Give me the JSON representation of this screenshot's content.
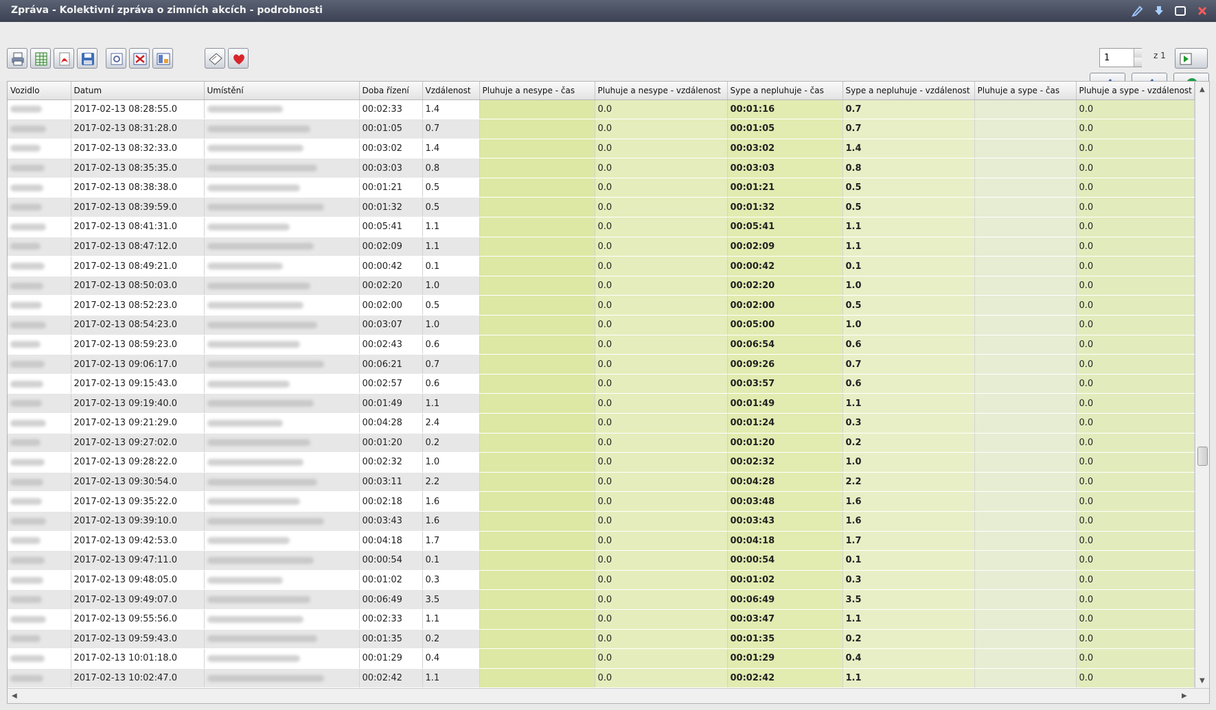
{
  "window": {
    "title": "Zpráva - Kolektivní zpráva o zimních akcích - podrobnosti"
  },
  "toolbar": {
    "icons": [
      "print-icon",
      "excel-export-icon",
      "pdf-export-icon",
      "save-icon",
      "preview-icon",
      "compare-icon",
      "layout-icon",
      "edit-note-icon",
      "favorite-icon"
    ],
    "pager": {
      "page": "1",
      "of_label": "z 1"
    },
    "right_icons": [
      "brush-icon",
      "brush-icon",
      "globe-icon"
    ]
  },
  "table": {
    "columns": [
      "Vozidlo",
      "Datum",
      "Umístění",
      "Doba řízení",
      "Vzdálenost",
      "Pluhuje a nesype - čas",
      "Pluhuje a nesype - vzdálenost",
      "Sype a nepluhuje - čas",
      "Sype a nepluhuje - vzdálenost",
      "Pluhuje a sype - čas",
      "Pluhuje a sype - vzdálenost"
    ],
    "rows": [
      {
        "date": "2017-02-13 08:28:55.0",
        "drive": "00:02:33",
        "dist": "1.4",
        "pn_dist": "0.0",
        "sn_time": "00:01:16",
        "sn_dist": "0.7",
        "ps_dist": "0.0"
      },
      {
        "date": "2017-02-13 08:31:28.0",
        "drive": "00:01:05",
        "dist": "0.7",
        "pn_dist": "0.0",
        "sn_time": "00:01:05",
        "sn_dist": "0.7",
        "ps_dist": "0.0"
      },
      {
        "date": "2017-02-13 08:32:33.0",
        "drive": "00:03:02",
        "dist": "1.4",
        "pn_dist": "0.0",
        "sn_time": "00:03:02",
        "sn_dist": "1.4",
        "ps_dist": "0.0"
      },
      {
        "date": "2017-02-13 08:35:35.0",
        "drive": "00:03:03",
        "dist": "0.8",
        "pn_dist": "0.0",
        "sn_time": "00:03:03",
        "sn_dist": "0.8",
        "ps_dist": "0.0"
      },
      {
        "date": "2017-02-13 08:38:38.0",
        "drive": "00:01:21",
        "dist": "0.5",
        "pn_dist": "0.0",
        "sn_time": "00:01:21",
        "sn_dist": "0.5",
        "ps_dist": "0.0"
      },
      {
        "date": "2017-02-13 08:39:59.0",
        "drive": "00:01:32",
        "dist": "0.5",
        "pn_dist": "0.0",
        "sn_time": "00:01:32",
        "sn_dist": "0.5",
        "ps_dist": "0.0"
      },
      {
        "date": "2017-02-13 08:41:31.0",
        "drive": "00:05:41",
        "dist": "1.1",
        "pn_dist": "0.0",
        "sn_time": "00:05:41",
        "sn_dist": "1.1",
        "ps_dist": "0.0"
      },
      {
        "date": "2017-02-13 08:47:12.0",
        "drive": "00:02:09",
        "dist": "1.1",
        "pn_dist": "0.0",
        "sn_time": "00:02:09",
        "sn_dist": "1.1",
        "ps_dist": "0.0"
      },
      {
        "date": "2017-02-13 08:49:21.0",
        "drive": "00:00:42",
        "dist": "0.1",
        "pn_dist": "0.0",
        "sn_time": "00:00:42",
        "sn_dist": "0.1",
        "ps_dist": "0.0"
      },
      {
        "date": "2017-02-13 08:50:03.0",
        "drive": "00:02:20",
        "dist": "1.0",
        "pn_dist": "0.0",
        "sn_time": "00:02:20",
        "sn_dist": "1.0",
        "ps_dist": "0.0"
      },
      {
        "date": "2017-02-13 08:52:23.0",
        "drive": "00:02:00",
        "dist": "0.5",
        "pn_dist": "0.0",
        "sn_time": "00:02:00",
        "sn_dist": "0.5",
        "ps_dist": "0.0"
      },
      {
        "date": "2017-02-13 08:54:23.0",
        "drive": "00:03:07",
        "dist": "1.0",
        "pn_dist": "0.0",
        "sn_time": "00:05:00",
        "sn_dist": "1.0",
        "ps_dist": "0.0"
      },
      {
        "date": "2017-02-13 08:59:23.0",
        "drive": "00:02:43",
        "dist": "0.6",
        "pn_dist": "0.0",
        "sn_time": "00:06:54",
        "sn_dist": "0.6",
        "ps_dist": "0.0"
      },
      {
        "date": "2017-02-13 09:06:17.0",
        "drive": "00:06:21",
        "dist": "0.7",
        "pn_dist": "0.0",
        "sn_time": "00:09:26",
        "sn_dist": "0.7",
        "ps_dist": "0.0"
      },
      {
        "date": "2017-02-13 09:15:43.0",
        "drive": "00:02:57",
        "dist": "0.6",
        "pn_dist": "0.0",
        "sn_time": "00:03:57",
        "sn_dist": "0.6",
        "ps_dist": "0.0"
      },
      {
        "date": "2017-02-13 09:19:40.0",
        "drive": "00:01:49",
        "dist": "1.1",
        "pn_dist": "0.0",
        "sn_time": "00:01:49",
        "sn_dist": "1.1",
        "ps_dist": "0.0"
      },
      {
        "date": "2017-02-13 09:21:29.0",
        "drive": "00:04:28",
        "dist": "2.4",
        "pn_dist": "0.0",
        "sn_time": "00:01:24",
        "sn_dist": "0.3",
        "ps_dist": "0.0"
      },
      {
        "date": "2017-02-13 09:27:02.0",
        "drive": "00:01:20",
        "dist": "0.2",
        "pn_dist": "0.0",
        "sn_time": "00:01:20",
        "sn_dist": "0.2",
        "ps_dist": "0.0"
      },
      {
        "date": "2017-02-13 09:28:22.0",
        "drive": "00:02:32",
        "dist": "1.0",
        "pn_dist": "0.0",
        "sn_time": "00:02:32",
        "sn_dist": "1.0",
        "ps_dist": "0.0"
      },
      {
        "date": "2017-02-13 09:30:54.0",
        "drive": "00:03:11",
        "dist": "2.2",
        "pn_dist": "0.0",
        "sn_time": "00:04:28",
        "sn_dist": "2.2",
        "ps_dist": "0.0"
      },
      {
        "date": "2017-02-13 09:35:22.0",
        "drive": "00:02:18",
        "dist": "1.6",
        "pn_dist": "0.0",
        "sn_time": "00:03:48",
        "sn_dist": "1.6",
        "ps_dist": "0.0"
      },
      {
        "date": "2017-02-13 09:39:10.0",
        "drive": "00:03:43",
        "dist": "1.6",
        "pn_dist": "0.0",
        "sn_time": "00:03:43",
        "sn_dist": "1.6",
        "ps_dist": "0.0"
      },
      {
        "date": "2017-02-13 09:42:53.0",
        "drive": "00:04:18",
        "dist": "1.7",
        "pn_dist": "0.0",
        "sn_time": "00:04:18",
        "sn_dist": "1.7",
        "ps_dist": "0.0"
      },
      {
        "date": "2017-02-13 09:47:11.0",
        "drive": "00:00:54",
        "dist": "0.1",
        "pn_dist": "0.0",
        "sn_time": "00:00:54",
        "sn_dist": "0.1",
        "ps_dist": "0.0"
      },
      {
        "date": "2017-02-13 09:48:05.0",
        "drive": "00:01:02",
        "dist": "0.3",
        "pn_dist": "0.0",
        "sn_time": "00:01:02",
        "sn_dist": "0.3",
        "ps_dist": "0.0"
      },
      {
        "date": "2017-02-13 09:49:07.0",
        "drive": "00:06:49",
        "dist": "3.5",
        "pn_dist": "0.0",
        "sn_time": "00:06:49",
        "sn_dist": "3.5",
        "ps_dist": "0.0"
      },
      {
        "date": "2017-02-13 09:55:56.0",
        "drive": "00:02:33",
        "dist": "1.1",
        "pn_dist": "0.0",
        "sn_time": "00:03:47",
        "sn_dist": "1.1",
        "ps_dist": "0.0"
      },
      {
        "date": "2017-02-13 09:59:43.0",
        "drive": "00:01:35",
        "dist": "0.2",
        "pn_dist": "0.0",
        "sn_time": "00:01:35",
        "sn_dist": "0.2",
        "ps_dist": "0.0"
      },
      {
        "date": "2017-02-13 10:01:18.0",
        "drive": "00:01:29",
        "dist": "0.4",
        "pn_dist": "0.0",
        "sn_time": "00:01:29",
        "sn_dist": "0.4",
        "ps_dist": "0.0"
      },
      {
        "date": "2017-02-13 10:02:47.0",
        "drive": "00:02:42",
        "dist": "1.1",
        "pn_dist": "0.0",
        "sn_time": "00:02:42",
        "sn_dist": "1.1",
        "ps_dist": "0.0"
      }
    ]
  }
}
